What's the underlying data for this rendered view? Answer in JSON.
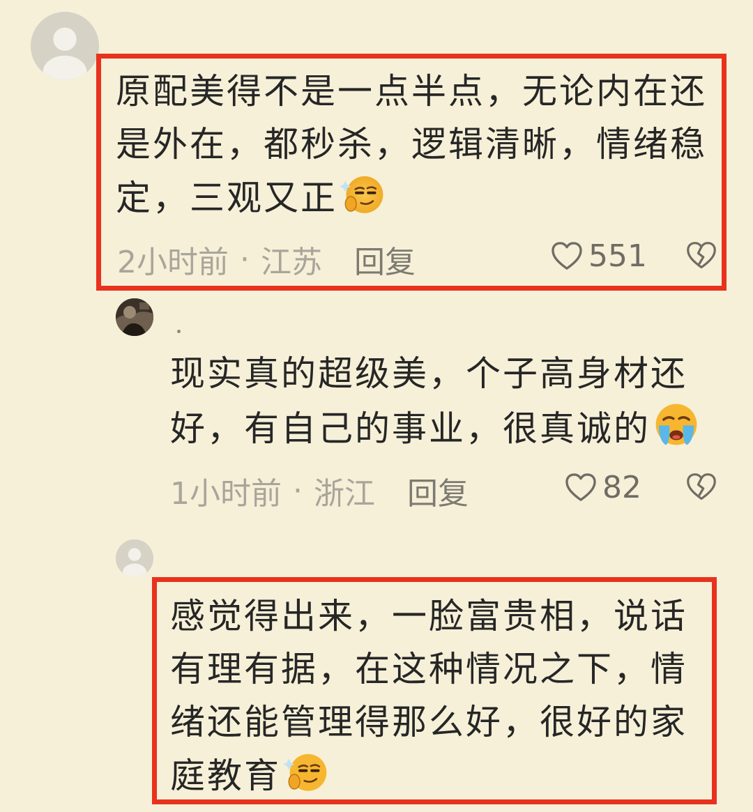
{
  "comments": [
    {
      "text_lines": [
        "原配美得不是一点半点，无论内在还",
        "是外在，都秒杀，逻辑清晰，情绪稳",
        "定，三观又正"
      ],
      "emoji": "smirk-face-emoji",
      "time": "2小时前",
      "location": "江苏",
      "separator": "·",
      "reply_label": "回复",
      "likes": "551"
    },
    {
      "nickname": "·",
      "text_lines": [
        "现实真的超级美，个子高身材还",
        "好，有自己的事业，很真诚的"
      ],
      "emoji": "crying-face-emoji",
      "time": "1小时前",
      "location": "浙江",
      "separator": "·",
      "reply_label": "回复",
      "likes": "82"
    },
    {
      "text_lines": [
        "感觉得出来，一脸富贵相，说话",
        "有理有据，在这种情况之下，情",
        "绪还能管理得那么好，很好的家",
        "庭教育"
      ],
      "emoji": "smirk-face-emoji"
    }
  ],
  "colors": {
    "background": "#f6f0d8",
    "highlight_border": "#e8321e",
    "text": "#262626",
    "meta_text": "#a9a59b"
  }
}
